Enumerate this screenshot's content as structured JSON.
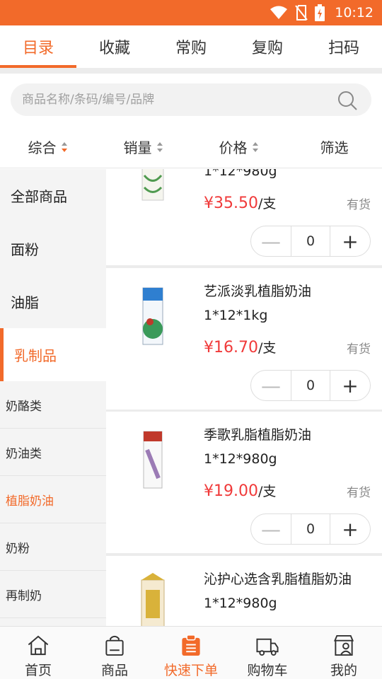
{
  "status_bar": {
    "time": "10:12"
  },
  "top_tabs": [
    {
      "label": "目录",
      "active": true
    },
    {
      "label": "收藏",
      "active": false
    },
    {
      "label": "常购",
      "active": false
    },
    {
      "label": "复购",
      "active": false
    },
    {
      "label": "扫码",
      "active": false
    }
  ],
  "search": {
    "placeholder": "商品名称/条码/编号/品牌"
  },
  "sort_bar": [
    {
      "label": "综合",
      "arrows": true,
      "active": true
    },
    {
      "label": "销量",
      "arrows": true,
      "active": false
    },
    {
      "label": "价格",
      "arrows": true,
      "active": false
    },
    {
      "label": "筛选",
      "arrows": false,
      "active": false
    }
  ],
  "categories": {
    "main": [
      {
        "label": "全部商品",
        "active": false
      },
      {
        "label": "面粉",
        "active": false
      },
      {
        "label": "油脂",
        "active": false
      },
      {
        "label": "乳制品",
        "active": true
      }
    ],
    "sub": [
      {
        "label": "奶酪类",
        "active": false
      },
      {
        "label": "奶油类",
        "active": false
      },
      {
        "label": "植脂奶油",
        "active": true
      },
      {
        "label": "奶粉",
        "active": false
      },
      {
        "label": "再制奶",
        "active": false
      }
    ]
  },
  "products": [
    {
      "name": "",
      "spec": "1*12*980g",
      "price": "¥35.50",
      "unit": "/支",
      "stock": "有货",
      "qty": "0",
      "img_color": "#6aa86a"
    },
    {
      "name": "艺派淡乳植脂奶油",
      "spec": "1*12*1kg",
      "price": "¥16.70",
      "unit": "/支",
      "stock": "有货",
      "qty": "0",
      "img_color": "#2f7fd0"
    },
    {
      "name": "季歌乳脂植脂奶油",
      "spec": "1*12*980g",
      "price": "¥19.00",
      "unit": "/支",
      "stock": "有货",
      "qty": "0",
      "img_color": "#c0392b"
    },
    {
      "name": "沁护心选含乳脂植脂奶油",
      "spec": "1*12*980g",
      "price": "",
      "unit": "",
      "stock": "",
      "qty": "",
      "img_color": "#d9b23a"
    }
  ],
  "bottom_nav": [
    {
      "label": "首页",
      "icon": "home-icon",
      "active": false
    },
    {
      "label": "商品",
      "icon": "bag-icon",
      "active": false
    },
    {
      "label": "快速下单",
      "icon": "clipboard-icon",
      "active": true
    },
    {
      "label": "购物车",
      "icon": "truck-icon",
      "active": false
    },
    {
      "label": "我的",
      "icon": "user-store-icon",
      "active": false
    }
  ],
  "colors": {
    "accent": "#f26a2a",
    "price": "#f03a3a"
  }
}
